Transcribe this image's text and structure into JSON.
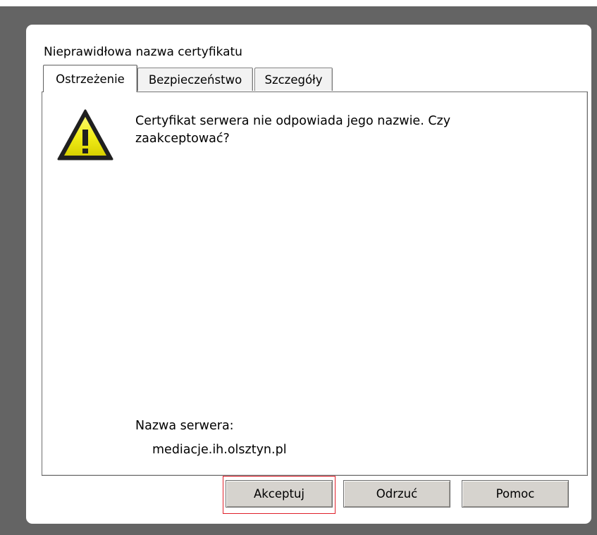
{
  "dialog": {
    "title": "Nieprawidłowa nazwa certyfikatu"
  },
  "tabs": [
    {
      "label": "Ostrzeżenie",
      "active": true
    },
    {
      "label": "Bezpieczeństwo",
      "active": false
    },
    {
      "label": "Szczegóły",
      "active": false
    }
  ],
  "warning": {
    "icon": "warning-triangle-icon",
    "message": "Certyfikat serwera nie odpowiada jego nazwie. Czy zaakceptować?"
  },
  "server": {
    "label": "Nazwa serwera:",
    "name": "mediacje.ih.olsztyn.pl"
  },
  "buttons": {
    "accept": "Akceptuj",
    "reject": "Odrzuć",
    "help": "Pomoc"
  },
  "colors": {
    "focus_ring": "#e0202a",
    "warning_yellow": "#f2ee1a",
    "frame": "#646464"
  }
}
